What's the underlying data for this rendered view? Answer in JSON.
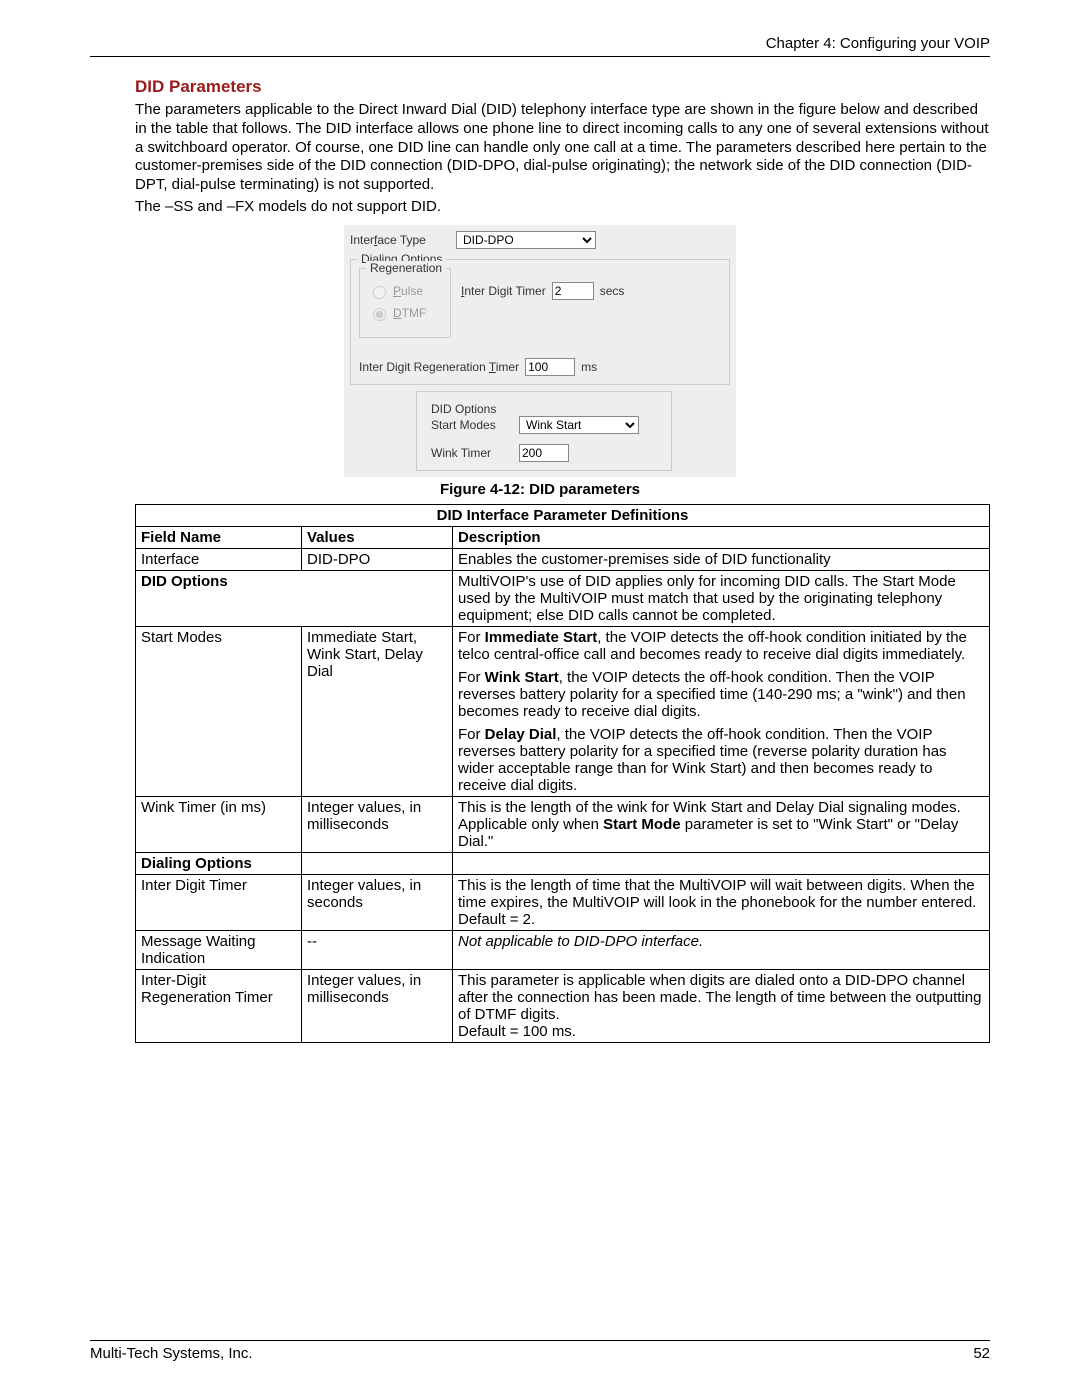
{
  "header": {
    "chapter": "Chapter 4: Configuring your VOIP"
  },
  "section": {
    "title": "DID Parameters"
  },
  "paragraphs": {
    "p1": "The parameters applicable to the Direct Inward Dial (DID) telephony interface type are shown in the figure below and described in the table that follows.  The DID interface allows one phone line to direct incoming calls to any one of several extensions without a switchboard operator.  Of course, one DID line can handle only one call at a time.  The parameters described here pertain to the customer-premises side of the DID connection (DID-DPO, dial-pulse originating); the network side of the DID connection (DID-DPT, dial-pulse terminating) is not supported.",
    "p2": "The –SS and –FX models do not support DID."
  },
  "screenshot": {
    "interface_type_label": "Interface Type",
    "interface_type_value": "DID-DPO",
    "dialing_options_legend": "Dialing Options",
    "regeneration_legend": "Regeneration",
    "radio_pulse": "Pulse",
    "radio_dtmf": "DTMF",
    "inter_digit_timer_label": "Inter Digit Timer",
    "inter_digit_timer_value": "2",
    "secs": "secs",
    "regen_timer_label": "Inter Digit Regeneration Timer",
    "regen_timer_value": "100",
    "ms": "ms",
    "did_options_legend": "DID Options",
    "start_modes_label": "Start Modes",
    "start_modes_value": "Wink Start",
    "wink_timer_label": "Wink Timer",
    "wink_timer_value": "200"
  },
  "figure_caption": "Figure 4-12: DID parameters",
  "table": {
    "title": "DID Interface Parameter Definitions",
    "headers": {
      "c1": "Field Name",
      "c2": "Values",
      "c3": "Description"
    },
    "rows": {
      "r1": {
        "c1": "Interface",
        "c2": "DID-DPO",
        "c3": "Enables the customer-premises side of DID functionality"
      },
      "r2": {
        "c1": "DID Options",
        "c3": "MultiVOIP's use of DID applies only for incoming DID calls.  The Start Mode used by the MultiVOIP must match that used by the originating telephony equipment; else DID calls cannot be completed."
      },
      "r3": {
        "c1": "Start Modes",
        "c2": "Immediate Start, Wink Start, Delay Dial",
        "c3a": "For ",
        "c3a_b": "Immediate Start",
        "c3a_t": ", the VOIP detects the off-hook condition initiated by the telco central-office call and becomes ready to receive dial digits immediately.",
        "c3b": "For ",
        "c3b_b": "Wink Start",
        "c3b_t": ", the VOIP detects the off-hook condition.  Then the VOIP reverses battery polarity for a specified time (140-290 ms; a \"wink\") and then becomes ready to receive dial digits.",
        "c3c": "For ",
        "c3c_b": "Delay Dial",
        "c3c_t": ", the VOIP detects the off-hook condition.  Then the VOIP reverses battery polarity for a specified time (reverse polarity duration has wider acceptable range than for Wink Start) and then becomes ready to receive dial digits."
      },
      "r4": {
        "c1": "Wink Timer (in ms)",
        "c2": "Integer values, in milliseconds",
        "c3a": "This is the length of the wink for Wink Start and Delay Dial signaling modes.",
        "c3b": "Applicable only when ",
        "c3b_b": "Start Mode",
        "c3b_t": " parameter is set to \"Wink Start\" or \"Delay Dial.\""
      },
      "r5": {
        "c1": "Dialing Options"
      },
      "r6": {
        "c1": "Inter Digit Timer",
        "c2": "Integer values, in seconds",
        "c3a": "This is the length of time that the MultiVOIP will wait between digits.  When the time expires, the MultiVOIP will look in the phonebook for the number entered.",
        "c3b": "Default = 2."
      },
      "r7": {
        "c1": "Message Waiting Indication",
        "c2": "--",
        "c3": "Not applicable to DID-DPO interface."
      },
      "r8": {
        "c1": "Inter-Digit Regeneration Timer",
        "c2": "Integer values, in milliseconds",
        "c3a": "This parameter is applicable when digits are dialed onto a DID-DPO channel after the connection has been made.  The length of time between the outputting of DTMF digits.",
        "c3b": "Default = 100 ms."
      }
    }
  },
  "footer": {
    "company": "Multi-Tech Systems, Inc.",
    "page": "52"
  }
}
